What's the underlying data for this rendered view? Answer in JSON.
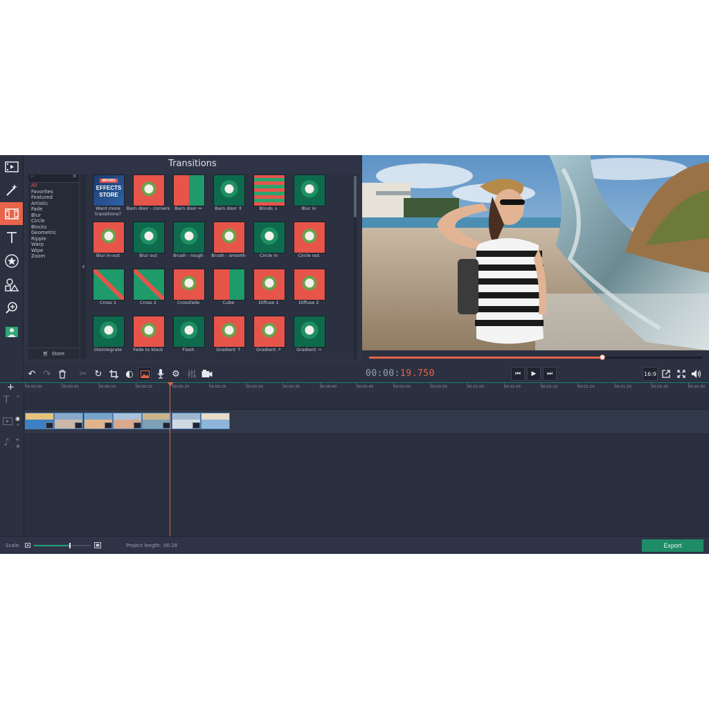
{
  "rail": {
    "items": [
      {
        "name": "import-icon"
      },
      {
        "name": "magic-wand-icon"
      },
      {
        "name": "transitions-icon",
        "active": true
      },
      {
        "name": "titles-icon"
      },
      {
        "name": "stickers-icon"
      },
      {
        "name": "shapes-icon"
      },
      {
        "name": "zoom-icon"
      },
      {
        "name": "chroma-icon"
      }
    ]
  },
  "transitions": {
    "title": "Transitions",
    "search_placeholder": "",
    "categories": [
      "All",
      "Favorites",
      "Featured",
      "Artistic",
      "Fade",
      "Blur",
      "Circle",
      "Blocks",
      "Geometric",
      "Ripple",
      "Warp",
      "Wipe",
      "Zoom"
    ],
    "selected_category": "All",
    "store_label": "Store",
    "store_tile": {
      "line1": "MOVAVI",
      "line2": "EFFECTS",
      "line3": "STORE"
    },
    "items": [
      {
        "label": "Want more transitions?",
        "style": "store"
      },
      {
        "label": "Barn door - corners",
        "style": "red"
      },
      {
        "label": "Barn door ↔",
        "style": "split"
      },
      {
        "label": "Barn door ↕",
        "style": "green"
      },
      {
        "label": "Blinds ↓",
        "style": "blinds"
      },
      {
        "label": "Blur in",
        "style": "green"
      },
      {
        "label": "Blur in-out",
        "style": "red"
      },
      {
        "label": "Blur out",
        "style": "green"
      },
      {
        "label": "Brush - rough",
        "style": "green"
      },
      {
        "label": "Brush - smooth",
        "style": "red"
      },
      {
        "label": "Circle in",
        "style": "green"
      },
      {
        "label": "Circle out",
        "style": "red"
      },
      {
        "label": "Cross 1",
        "style": "cross"
      },
      {
        "label": "Cross 2",
        "style": "cross"
      },
      {
        "label": "Crossfade",
        "style": "red"
      },
      {
        "label": "Cube",
        "style": "split"
      },
      {
        "label": "Diffuse 1",
        "style": "red"
      },
      {
        "label": "Diffuse 2",
        "style": "red"
      },
      {
        "label": "Disintegrate",
        "style": "green"
      },
      {
        "label": "Fade to black",
        "style": "red"
      },
      {
        "label": "Flash",
        "style": "green"
      },
      {
        "label": "Gradient ↑",
        "style": "red"
      },
      {
        "label": "Gradient ↗",
        "style": "red"
      },
      {
        "label": "Gradient →",
        "style": "green"
      }
    ]
  },
  "preview": {
    "progress": 0.7
  },
  "toolbar": {
    "timecode_prefix": "00:00:",
    "timecode_value": "19.750",
    "aspect_label": "16:9"
  },
  "timeline": {
    "ticks": [
      "00:00:00",
      "00:00:05",
      "00:00:10",
      "00:00:15",
      "00:00:20",
      "00:00:25",
      "00:00:30",
      "00:00:35",
      "00:00:40",
      "00:00:45",
      "00:00:50",
      "00:00:55",
      "00:01:00",
      "00:01:05",
      "00:01:10",
      "00:01:15",
      "00:01:20",
      "00:01:25",
      "00:01:30"
    ],
    "clip_count": 7
  },
  "status": {
    "scale_label": "Scale:",
    "scale_value": 0.62,
    "project_length_label": "Project length:",
    "project_length_value": "00:28",
    "export_label": "Export"
  },
  "colors": {
    "accent": "#e8644a",
    "export": "#1e8c66",
    "background": "#2b3140"
  }
}
